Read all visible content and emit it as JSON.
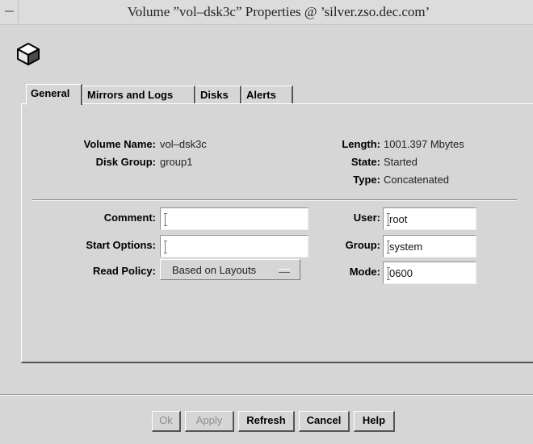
{
  "window": {
    "title": "Volume ˮvol–dsk3cˮ Properties @ ’silver.zso.dec.com’"
  },
  "header": {
    "icon": "cube-icon"
  },
  "tabs": [
    {
      "label": "General",
      "active": true
    },
    {
      "label": "Mirrors and Logs",
      "active": false
    },
    {
      "label": "Disks",
      "active": false
    },
    {
      "label": "Alerts",
      "active": false
    }
  ],
  "info": {
    "volume_name_label": "Volume Name:",
    "volume_name_value": "vol–dsk3c",
    "disk_group_label": "Disk Group:",
    "disk_group_value": "group1",
    "length_label": "Length:",
    "length_value": "1001.397 Mbytes",
    "state_label": "State:",
    "state_value": "Started",
    "type_label": "Type:",
    "type_value": "Concatenated"
  },
  "form": {
    "comment_label": "Comment:",
    "comment_value": "",
    "start_options_label": "Start Options:",
    "start_options_value": "",
    "read_policy_label": "Read Policy:",
    "read_policy_value": "Based on Layouts",
    "user_label": "User:",
    "user_value": "root",
    "group_label": "Group:",
    "group_value": "system",
    "mode_label": "Mode:",
    "mode_value": "0600"
  },
  "buttons": {
    "ok": "Ok",
    "apply": "Apply",
    "refresh": "Refresh",
    "cancel": "Cancel",
    "help": "Help"
  }
}
